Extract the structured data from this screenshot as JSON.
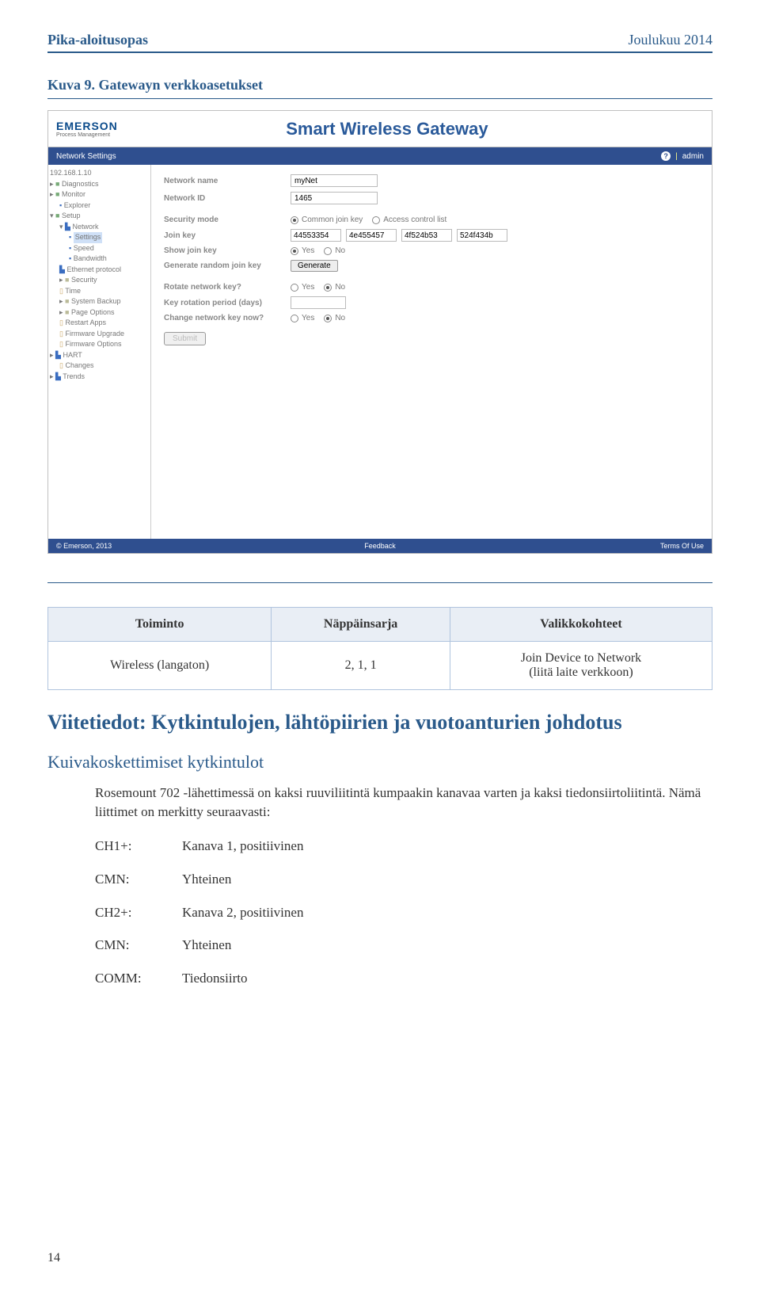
{
  "header": {
    "left": "Pika-aloitusopas",
    "right": "Joulukuu 2014"
  },
  "figure": {
    "title": "Kuva 9. Gatewayn verkkoasetukset"
  },
  "screenshot": {
    "logo": "EMERSON",
    "logo_sub": "Process Management",
    "title": "Smart Wireless Gateway",
    "breadcrumb": "Network Settings",
    "user": "admin",
    "tree": {
      "ip": "192.168.1.10",
      "diagnostics": "Diagnostics",
      "monitor": "Monitor",
      "explorer": "Explorer",
      "setup": "Setup",
      "network": "Network",
      "settings": "Settings",
      "speed": "Speed",
      "bandwidth": "Bandwidth",
      "ethernet": "Ethernet protocol",
      "security": "Security",
      "time": "Time",
      "backup": "System Backup",
      "page": "Page Options",
      "restart": "Restart Apps",
      "fwupgrade": "Firmware Upgrade",
      "fwoptions": "Firmware Options",
      "hart": "HART",
      "changes": "Changes",
      "trends": "Trends"
    },
    "form": {
      "network_name_label": "Network name",
      "network_name_value": "myNet",
      "network_id_label": "Network ID",
      "network_id_value": "1465",
      "security_mode_label": "Security mode",
      "security_opt1": "Common join key",
      "security_opt2": "Access control list",
      "join_key_label": "Join key",
      "key1": "44553354",
      "key2": "4e455457",
      "key3": "4f524b53",
      "key4": "524f434b",
      "show_key_label": "Show join key",
      "generate_label": "Generate random join key",
      "generate_btn": "Generate",
      "rotate_label": "Rotate network key?",
      "rotation_period_label": "Key rotation period (days)",
      "change_now_label": "Change network key now?",
      "yes": "Yes",
      "no": "No",
      "submit": "Submit"
    },
    "footer": {
      "copyright": "© Emerson, 2013",
      "feedback": "Feedback",
      "terms": "Terms Of Use"
    }
  },
  "table": {
    "head1": "Toiminto",
    "head2": "Näppäinsarja",
    "head3": "Valikkokohteet",
    "row1_c1": "Wireless (langaton)",
    "row1_c2": "2, 1, 1",
    "row1_c3_l1": "Join Device to Network",
    "row1_c3_l2": "(liitä laite verkkoon)"
  },
  "section": {
    "title": "Viitetiedot: Kytkintulojen, lähtöpiirien ja vuotoanturien johdotus",
    "sub": "Kuivakoskettimiset kytkintulot",
    "body": "Rosemount 702 -lähettimessä on kaksi ruuviliitintä kumpaakin kanavaa varten ja kaksi tiedonsiirtoliitintä. Nämä liittimet on merkitty seuraavasti:"
  },
  "defs": {
    "r1t": "CH1+:",
    "r1v": "Kanava 1, positiivinen",
    "r2t": "CMN:",
    "r2v": "Yhteinen",
    "r3t": "CH2+:",
    "r3v": "Kanava 2, positiivinen",
    "r4t": "CMN:",
    "r4v": "Yhteinen",
    "r5t": "COMM:",
    "r5v": "Tiedonsiirto"
  },
  "page_num": "14"
}
